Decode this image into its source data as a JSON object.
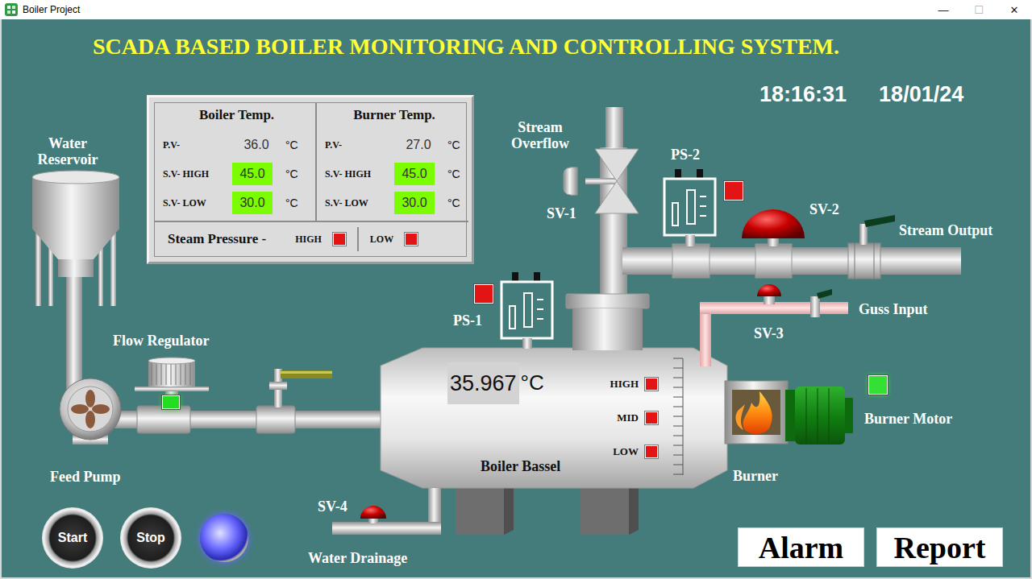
{
  "window": {
    "title": "Boiler Project",
    "controls": [
      {
        "glyph": "—",
        "disabled": false
      },
      {
        "glyph": "☐",
        "disabled": true
      },
      {
        "glyph": "✕",
        "disabled": false
      }
    ]
  },
  "header": {
    "title": "SCADA BASED BOILER MONITORING AND CONTROLLING SYSTEM.",
    "time": "18:16:31",
    "date": "18/01/24"
  },
  "temperature_panel": {
    "sections": [
      {
        "title": "Boiler Temp.",
        "rows": [
          {
            "label": "P.V-",
            "value": "36.0",
            "unit": "°C",
            "kind": "reading"
          },
          {
            "label": "S.V- HIGH",
            "value": "45.0",
            "unit": "°C",
            "kind": "setpoint"
          },
          {
            "label": "S.V- LOW",
            "value": "30.0",
            "unit": "°C",
            "kind": "setpoint"
          }
        ]
      },
      {
        "title": "Burner Temp.",
        "rows": [
          {
            "label": "P.V-",
            "value": "27.0",
            "unit": "°C",
            "kind": "reading"
          },
          {
            "label": "S.V- HIGH",
            "value": "45.0",
            "unit": "°C",
            "kind": "setpoint"
          },
          {
            "label": "S.V- LOW",
            "value": "30.0",
            "unit": "°C",
            "kind": "setpoint"
          }
        ]
      }
    ],
    "steam_pressure": {
      "label": "Steam Pressure -",
      "indicators": [
        {
          "label": "HIGH",
          "on": false,
          "color": "#e31414"
        },
        {
          "label": "LOW",
          "on": false,
          "color": "#e31414"
        }
      ]
    }
  },
  "labels": {
    "water_reservoir": "Water Reservoir",
    "flow_regulator": "Flow Regulator",
    "feed_pump": "Feed Pump",
    "stream_overflow": "Stream Overflow",
    "sv1": "SV-1",
    "ps2": "PS-2",
    "sv2": "SV-2",
    "stream_output": "Stream Output",
    "ps1": "PS-1",
    "sv3": "SV-3",
    "guss_input": "Guss Input",
    "burner_motor": "Burner Motor",
    "burner": "Burner",
    "boiler": "Boiler Bassel",
    "sv4": "SV-4",
    "water_drainage": "Water Drainage"
  },
  "boiler": {
    "reading": "35.967",
    "unit": "°C",
    "levels": [
      {
        "label": "HIGH",
        "on": false,
        "color": "#e31414"
      },
      {
        "label": "MID",
        "on": false,
        "color": "#e31414"
      },
      {
        "label": "LOW",
        "on": false,
        "color": "#e31414"
      }
    ]
  },
  "lamps": {
    "ps1": {
      "on": false,
      "color": "#e31414"
    },
    "ps2": {
      "on": false,
      "color": "#e31414"
    },
    "burner_motor": {
      "on": true,
      "color": "#33e033"
    },
    "flow_regulator": {
      "on": true,
      "color": "#22dd22"
    }
  },
  "controls": {
    "start": "Start",
    "stop": "Stop",
    "run_lamp": {
      "on": true,
      "color": "#6a6aff"
    }
  },
  "buttons": [
    "Alarm",
    "Report"
  ]
}
